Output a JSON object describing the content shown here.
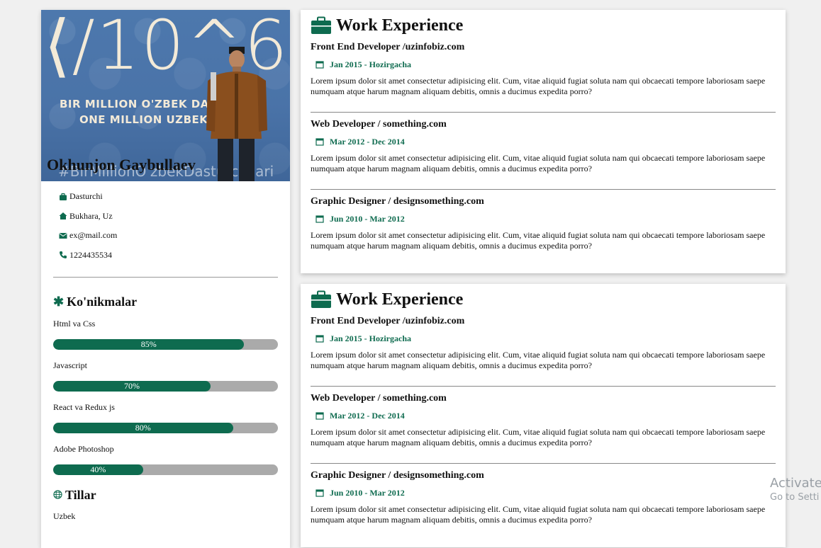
{
  "profile": {
    "photo_logo": "⟨/10^6⟩",
    "banner_line1": "BIR MILLION O'ZBEK DASTURCHI",
    "banner_line2": "ONE MILLION UZBEK CODERS",
    "hashtag": "#BirMillionO'zbekDasturchilari",
    "name": "Okhunjon Gaybullaev",
    "job": "Dasturchi",
    "location": "Bukhara, Uz",
    "email": "ex@mail.com",
    "phone": "1224435534"
  },
  "skills": {
    "title": "Ko'nikmalar",
    "items": [
      {
        "name": "Html va Css",
        "percent": 85,
        "label": "85%"
      },
      {
        "name": "Javascript",
        "percent": 70,
        "label": "70%"
      },
      {
        "name": "React va Redux js",
        "percent": 80,
        "label": "80%"
      },
      {
        "name": "Adobe Photoshop",
        "percent": 40,
        "label": "40%"
      }
    ]
  },
  "languages": {
    "title": "Tillar",
    "items": [
      "Uzbek"
    ]
  },
  "work_cards": [
    {
      "title": "Work Experience",
      "jobs": [
        {
          "title": "Front End Developer /uzinfobiz.com",
          "date": "Jan 2015 - Hozirgacha",
          "desc": "Lorem ipsum dolor sit amet consectetur adipisicing elit. Cum, vitae aliquid fugiat soluta nam qui obcaecati tempore laboriosam saepe numquam atque harum magnam aliquam debitis, omnis a ducimus expedita porro?"
        },
        {
          "title": "Web Developer / something.com",
          "date": "Mar 2012 - Dec 2014",
          "desc": "Lorem ipsum dolor sit amet consectetur adipisicing elit. Cum, vitae aliquid fugiat soluta nam qui obcaecati tempore laboriosam saepe numquam atque harum magnam aliquam debitis, omnis a ducimus expedita porro?"
        },
        {
          "title": "Graphic Designer / designsomething.com",
          "date": "Jun 2010 - Mar 2012",
          "desc": "Lorem ipsum dolor sit amet consectetur adipisicing elit. Cum, vitae aliquid fugiat soluta nam qui obcaecati tempore laboriosam saepe numquam atque harum magnam aliquam debitis, omnis a ducimus expedita porro?"
        }
      ]
    },
    {
      "title": "Work Experience",
      "jobs": [
        {
          "title": "Front End Developer /uzinfobiz.com",
          "date": "Jan 2015 - Hozirgacha",
          "desc": "Lorem ipsum dolor sit amet consectetur adipisicing elit. Cum, vitae aliquid fugiat soluta nam qui obcaecati tempore laboriosam saepe numquam atque harum magnam aliquam debitis, omnis a ducimus expedita porro?"
        },
        {
          "title": "Web Developer / something.com",
          "date": "Mar 2012 - Dec 2014",
          "desc": "Lorem ipsum dolor sit amet consectetur adipisicing elit. Cum, vitae aliquid fugiat soluta nam qui obcaecati tempore laboriosam saepe numquam atque harum magnam aliquam debitis, omnis a ducimus expedita porro?"
        },
        {
          "title": "Graphic Designer / designsomething.com",
          "date": "Jun 2010 - Mar 2012",
          "desc": "Lorem ipsum dolor sit amet consectetur adipisicing elit. Cum, vitae aliquid fugiat soluta nam qui obcaecati tempore laboriosam saepe numquam atque harum magnam aliquam debitis, omnis a ducimus expedita porro?"
        }
      ]
    }
  ],
  "watermark": {
    "line1": "Activate",
    "line2": "Go to Setti"
  },
  "colors": {
    "accent": "#0e6b4f",
    "bar_track": "#aaaaaa"
  },
  "icons": {
    "job": "briefcase-icon",
    "location": "home-icon",
    "email": "envelope-icon",
    "phone": "phone-icon",
    "skills": "asterisk-icon",
    "languages": "globe-icon",
    "work": "briefcase-icon",
    "date": "calendar-icon"
  }
}
